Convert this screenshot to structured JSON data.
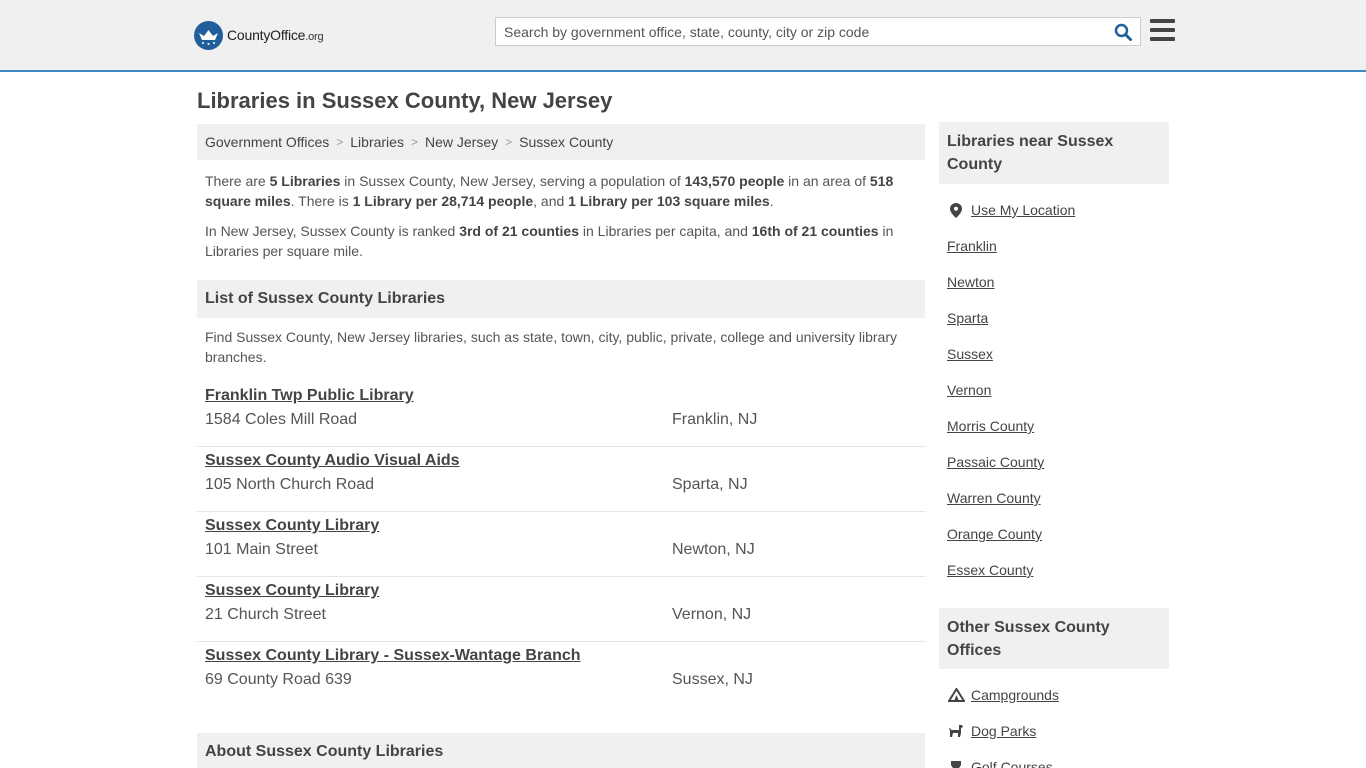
{
  "header": {
    "logo_text": "CountyOffice",
    "logo_tld": ".org",
    "search_placeholder": "Search by government office, state, county, city or zip code"
  },
  "page_title": "Libraries in Sussex County, New Jersey",
  "breadcrumb": [
    "Government Offices",
    "Libraries",
    "New Jersey",
    "Sussex County"
  ],
  "intro": {
    "p1": {
      "t1": "There are ",
      "count": "5 Libraries",
      "t2": " in Sussex County, New Jersey, serving a population of ",
      "population": "143,570 people",
      "t3": " in an area of ",
      "area": "518 square miles",
      "t4": ". There is ",
      "per_capita": "1 Library per 28,714 people",
      "t5": ", and ",
      "per_area": "1 Library per 103 square miles",
      "t6": "."
    },
    "p2": {
      "t1": "In New Jersey, Sussex County is ranked ",
      "rank_capita": "3rd of 21 counties",
      "t2": " in Libraries per capita, and ",
      "rank_area": "16th of 21 counties",
      "t3": " in Libraries per square mile."
    }
  },
  "list_section": {
    "title": "List of Sussex County Libraries",
    "description": "Find Sussex County, New Jersey libraries, such as state, town, city, public, private, college and university library branches."
  },
  "libraries": [
    {
      "name": "Franklin Twp Public Library",
      "address": "1584 Coles Mill Road",
      "city": "Franklin, NJ"
    },
    {
      "name": "Sussex County Audio Visual Aids",
      "address": "105 North Church Road",
      "city": "Sparta, NJ"
    },
    {
      "name": "Sussex County Library",
      "address": "101 Main Street",
      "city": "Newton, NJ"
    },
    {
      "name": "Sussex County Library",
      "address": "21 Church Street",
      "city": "Vernon, NJ"
    },
    {
      "name": "Sussex County Library - Sussex-Wantage Branch",
      "address": "69 County Road 639",
      "city": "Sussex, NJ"
    }
  ],
  "about_section": {
    "title": "About Sussex County Libraries"
  },
  "sidebar": {
    "nearby_title": "Libraries near Sussex County",
    "use_location": "Use My Location",
    "nearby": [
      "Franklin",
      "Newton",
      "Sparta",
      "Sussex",
      "Vernon",
      "Morris County",
      "Passaic County",
      "Warren County",
      "Orange County",
      "Essex County"
    ],
    "other_title": "Other Sussex County Offices",
    "other": [
      {
        "label": "Campgrounds",
        "icon": "tent-icon"
      },
      {
        "label": "Dog Parks",
        "icon": "dog-icon"
      },
      {
        "label": "Golf Courses",
        "icon": "trophy-icon"
      }
    ]
  },
  "colors": {
    "brand": "#1f5f9b",
    "accent": "#3f88c5",
    "panel": "#f0f0f0"
  }
}
